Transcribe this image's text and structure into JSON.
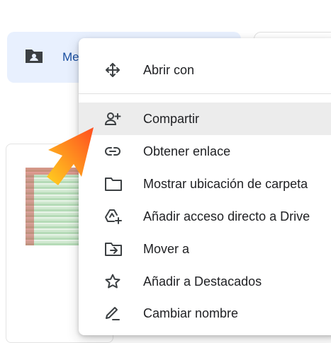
{
  "folder_chip": {
    "label": "Me",
    "icon": "shared-folder-icon"
  },
  "menu": {
    "items": [
      {
        "label": "Abrir con",
        "icon": "move-arrows-icon"
      },
      {
        "label": "Compartir",
        "icon": "add-person-icon",
        "highlighted": true
      },
      {
        "label": "Obtener enlace",
        "icon": "link-icon"
      },
      {
        "label": "Mostrar ubicación de carpeta",
        "icon": "folder-icon"
      },
      {
        "label": "Añadir acceso directo a Drive",
        "icon": "add-shortcut-icon"
      },
      {
        "label": "Mover a",
        "icon": "move-to-folder-icon"
      },
      {
        "label": "Añadir a Destacados",
        "icon": "star-icon"
      },
      {
        "label": "Cambiar nombre",
        "icon": "pencil-icon"
      }
    ]
  },
  "colors": {
    "chip_bg": "#e8f0fe",
    "highlight_bg": "#ececec",
    "text": "#202124",
    "pointer_gradient": [
      "#ffd21f",
      "#ff5a1f"
    ]
  }
}
